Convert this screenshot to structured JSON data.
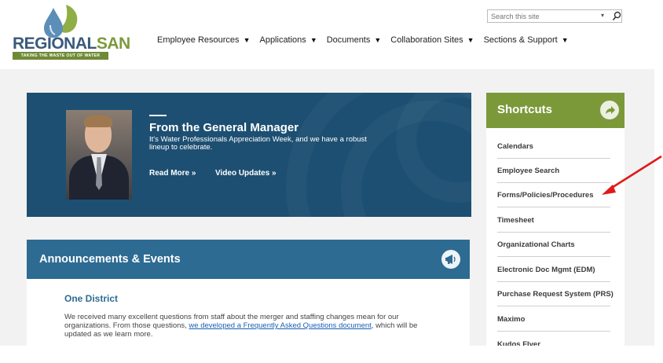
{
  "logo": {
    "name_part1": "REGIONAL",
    "name_part2": "SAN",
    "tagline": "TAKING THE WASTE OUT OF WATER"
  },
  "nav": {
    "items": [
      {
        "label": "Employee Resources"
      },
      {
        "label": "Applications"
      },
      {
        "label": "Documents"
      },
      {
        "label": "Collaboration Sites"
      },
      {
        "label": "Sections & Support"
      }
    ],
    "caret": "▼"
  },
  "search": {
    "placeholder": "Search this site",
    "dropdown_glyph": "▾"
  },
  "hero": {
    "title": "From the General Manager",
    "text": "It's Water Professionals Appreciation Week, and we have a robust lineup to celebrate.",
    "read_more": "Read More »",
    "video_updates": "Video Updates »"
  },
  "announcements": {
    "title": "Announcements & Events",
    "item_title": "One District",
    "text_before": "We received many excellent questions from staff about the merger and staffing changes mean for our organizations. From those questions, ",
    "link_text": "we developed a Frequently Asked Questions document",
    "text_after": ", which will be updated as we learn more."
  },
  "shortcuts": {
    "title": "Shortcuts",
    "items": [
      {
        "label": "Calendars"
      },
      {
        "label": "Employee Search"
      },
      {
        "label": "Forms/Policies/Procedures"
      },
      {
        "label": "Timesheet"
      },
      {
        "label": "Organizational Charts"
      },
      {
        "label": "Electronic Doc Mgmt (EDM)"
      },
      {
        "label": "Purchase Request System (PRS)"
      },
      {
        "label": "Maximo"
      },
      {
        "label": "Kudos Flyer"
      }
    ]
  },
  "colors": {
    "hero_bg": "#1d4f72",
    "announcements_bg": "#2e6b93",
    "shortcuts_bg": "#7c993a",
    "annotation_arrow": "#e01a1a"
  }
}
